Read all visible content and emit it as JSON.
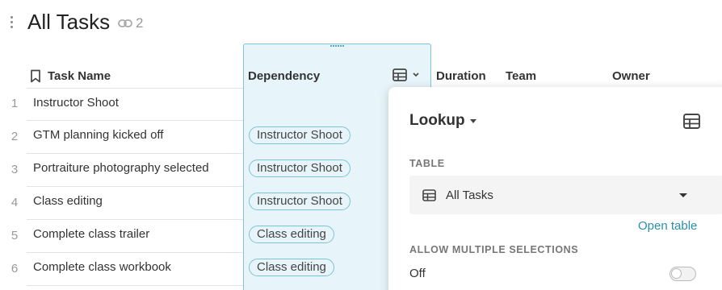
{
  "page": {
    "title": "All Tasks",
    "link_count": "2"
  },
  "columns": {
    "task_name": "Task Name",
    "dependency": "Dependency",
    "duration": "Duration",
    "team": "Team",
    "owner": "Owner"
  },
  "rows": [
    {
      "num": "1",
      "task": "Instructor Shoot",
      "dependency": ""
    },
    {
      "num": "2",
      "task": "GTM planning kicked off",
      "dependency": "Instructor Shoot"
    },
    {
      "num": "3",
      "task": "Portraiture photography selected",
      "dependency": "Instructor Shoot"
    },
    {
      "num": "4",
      "task": "Class editing",
      "dependency": "Instructor Shoot"
    },
    {
      "num": "5",
      "task": "Complete class trailer",
      "dependency": "Class editing"
    },
    {
      "num": "6",
      "task": "Complete class workbook",
      "dependency": "Class editing"
    }
  ],
  "panel": {
    "type": "Lookup",
    "table_label": "TABLE",
    "table_value": "All Tasks",
    "open_table": "Open table",
    "multi_label": "ALLOW MULTIPLE SELECTIONS",
    "multi_value": "Off",
    "multi_enabled": false
  },
  "colors": {
    "accent": "#2b8fa8",
    "column_highlight": "#e7f5fa",
    "pill_border": "#7bc3d4"
  }
}
